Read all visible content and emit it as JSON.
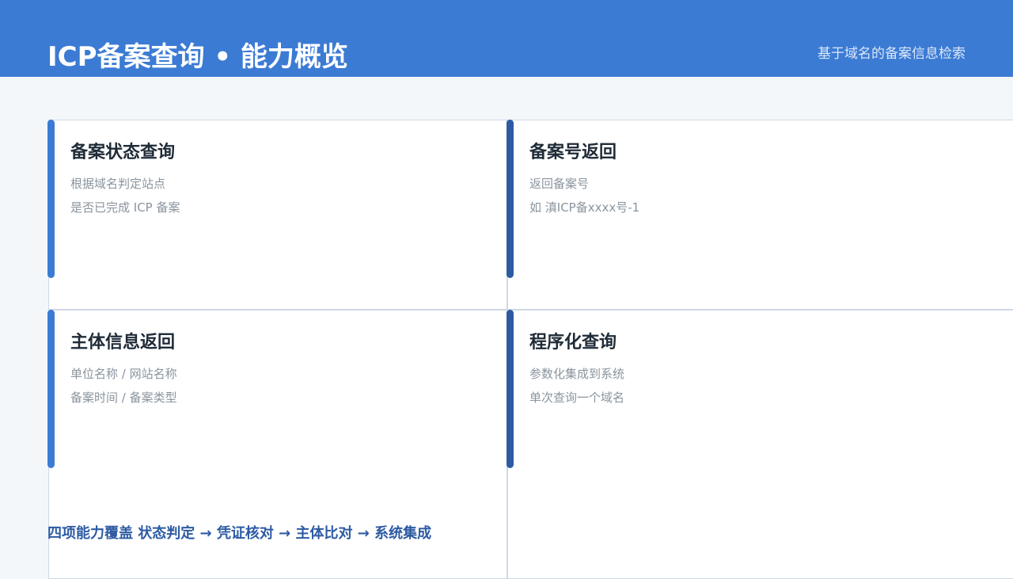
{
  "header": {
    "title": "ICP备案查询 • 能力概览",
    "subtitle": "基于域名的备案信息检索"
  },
  "cards": [
    {
      "title": "备案状态查询",
      "lines": [
        "根据域名判定站点",
        "是否已完成 ICP 备案"
      ]
    },
    {
      "title": "备案号返回",
      "lines": [
        "返回备案号",
        "如 滇ICP备xxxx号-1"
      ]
    },
    {
      "title": "主体信息返回",
      "lines": [
        "单位名称 / 网站名称",
        "备案时间 / 备案类型"
      ]
    },
    {
      "title": "程序化查询",
      "lines": [
        "参数化集成到系统",
        "单次查询一个域名"
      ]
    }
  ],
  "footer": {
    "summary": "四项能力覆盖 状态判定 → 凭证核对 → 主体比对 → 系统集成"
  },
  "colors": {
    "header_bg": "#3b7bd4",
    "accent_light": "#3b7bd4",
    "accent_dark": "#2d5ba3",
    "page_bg": "#f4f7fa"
  }
}
